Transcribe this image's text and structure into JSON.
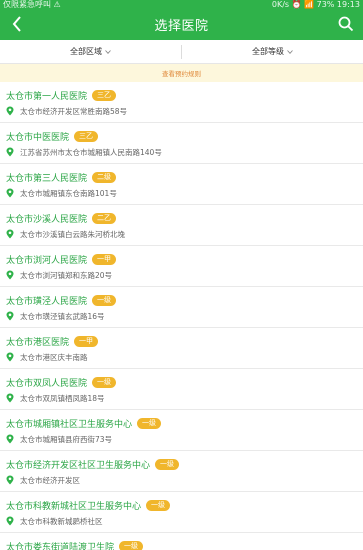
{
  "status": {
    "left": "仅限紧急呼叫 ⚠",
    "right": "0K/s ⏰ 📶 73% 19:13"
  },
  "header": {
    "title": "选择医院"
  },
  "filters": {
    "region": "全部区域",
    "level": "全部等级"
  },
  "notice": "查看预约规则",
  "hospitals": [
    {
      "name": "太仓市第一人民医院",
      "level": "三乙",
      "address": "太仓市经济开发区常胜南路58号"
    },
    {
      "name": "太仓市中医医院",
      "level": "三乙",
      "address": "江苏省苏州市太仓市城厢镇人民南路140号"
    },
    {
      "name": "太仓市第三人民医院",
      "level": "二级",
      "address": "太仓市城厢镇东仓南路101号"
    },
    {
      "name": "太仓市沙溪人民医院",
      "level": "二乙",
      "address": "太仓市沙溪镇白云路朱河桥北堍"
    },
    {
      "name": "太仓市浏河人民医院",
      "level": "一甲",
      "address": "太仓市浏河镇郑和东路20号"
    },
    {
      "name": "太仓市璜泾人民医院",
      "level": "一级",
      "address": "太仓市璜泾镇玄武路16号"
    },
    {
      "name": "太仓市港区医院",
      "level": "一甲",
      "address": "太仓市港区庆丰南路"
    },
    {
      "name": "太仓市双凤人民医院",
      "level": "一级",
      "address": "太仓市双凤镇栖凤路18号"
    },
    {
      "name": "太仓市城厢镇社区卫生服务中心",
      "level": "一级",
      "address": "太仓市城厢镇县府西街73号"
    },
    {
      "name": "太仓市经济开发区社区卫生服务中心",
      "level": "一级",
      "address": "太仓市经济开发区"
    },
    {
      "name": "太仓市科教新城社区卫生服务中心",
      "level": "一级",
      "address": "太仓市科教新城鹮桥社区"
    },
    {
      "name": "太仓市娄东街道陆渡卫生院",
      "level": "一级",
      "address": ""
    }
  ],
  "colors": {
    "brand_green": "#2fb24a",
    "badge_yellow": "#f0b62c",
    "notice_text": "#e08a3c"
  }
}
